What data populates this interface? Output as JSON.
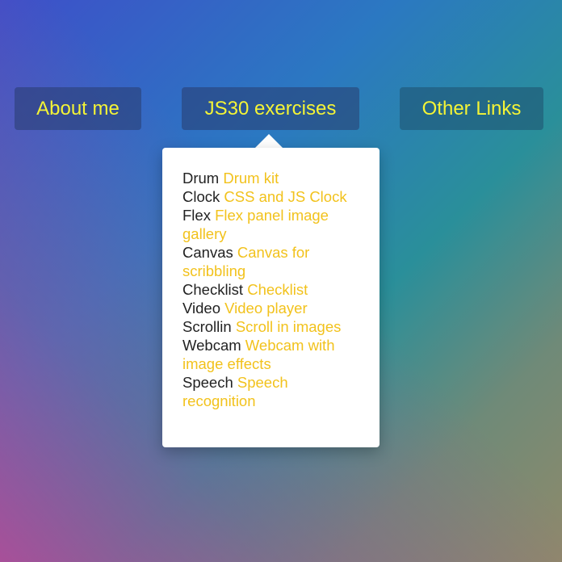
{
  "nav": {
    "items": [
      {
        "label": "About me"
      },
      {
        "label": "JS30 exercises"
      },
      {
        "label": "Other Links"
      }
    ]
  },
  "dropdown": {
    "items": [
      {
        "name": "Drum",
        "link": "Drum kit"
      },
      {
        "name": "Clock",
        "link": "CSS and JS Clock"
      },
      {
        "name": "Flex",
        "link": "Flex panel image gallery"
      },
      {
        "name": "Canvas",
        "link": "Canvas for scribbling"
      },
      {
        "name": "Checklist",
        "link": "Checklist"
      },
      {
        "name": "Video",
        "link": "Video player"
      },
      {
        "name": "Scrollin",
        "link": "Scroll in images"
      },
      {
        "name": "Webcam",
        "link": "Webcam with image effects"
      },
      {
        "name": "Speech",
        "link": "Speech recognition"
      }
    ]
  },
  "colors": {
    "nav_text": "#f4f436",
    "link": "#f2c21c",
    "panel": "#ffffff"
  }
}
